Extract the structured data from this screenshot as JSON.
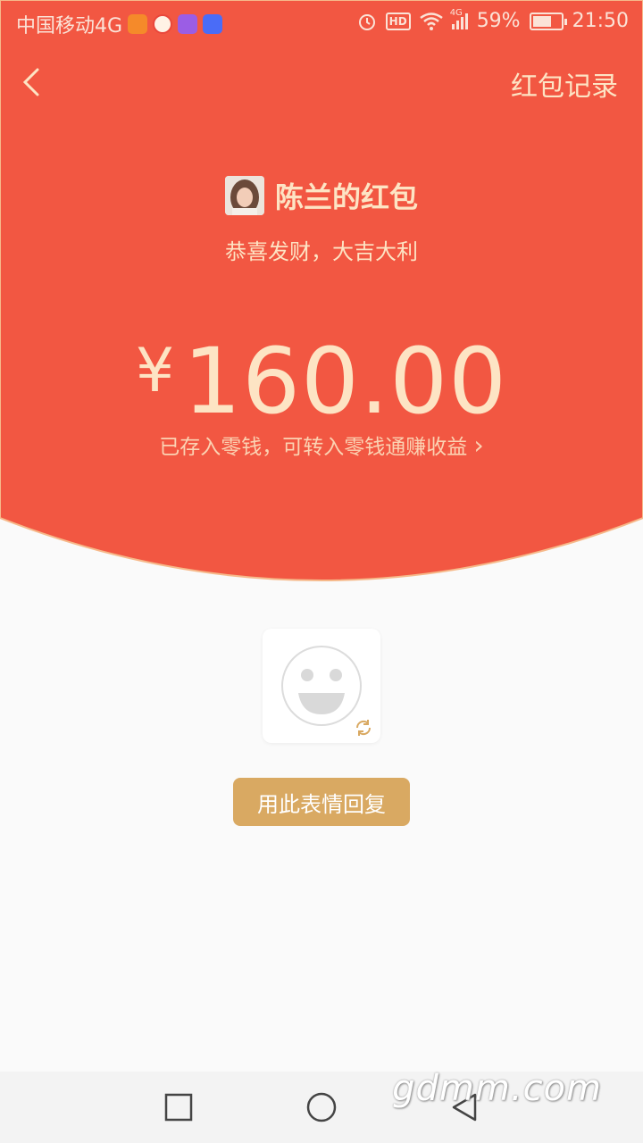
{
  "status_bar": {
    "carrier": "中国移动4G",
    "battery_percent": "59%",
    "time": "21:50",
    "hd_label": "HD",
    "network_small": "4G"
  },
  "header": {
    "record_label": "红包记录"
  },
  "packet": {
    "sender_name": "陈兰的红包",
    "greeting": "恭喜发财，大吉大利",
    "currency": "¥",
    "amount": "160.00",
    "savings_text": "已存入零钱，可转入零钱通赚收益",
    "savings_arrow": "›"
  },
  "sticker": {
    "reply_label": "用此表情回复"
  },
  "watermark": "gdmm.com",
  "colors": {
    "red": "#f25742",
    "gold": "#d9a962",
    "cream": "#fde4c4"
  }
}
